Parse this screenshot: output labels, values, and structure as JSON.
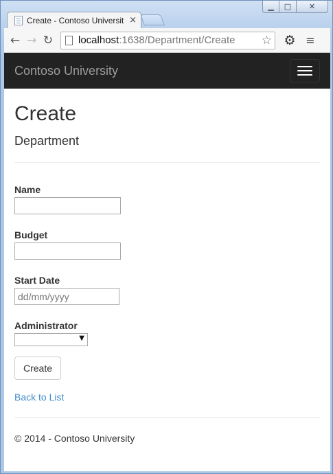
{
  "browser": {
    "tab_title": "Create - Contoso Universit",
    "tab_close": "×",
    "url_host": "localhost",
    "url_rest": ":1638/Department/Create",
    "window_min": "▁",
    "window_max": "□",
    "window_close": "✕",
    "back": "←",
    "forward": "→",
    "reload": "↻",
    "star": "☆",
    "gear": "⚙",
    "menu": "≡"
  },
  "navbar": {
    "brand": "Contoso University"
  },
  "main": {
    "title": "Create",
    "subtitle": "Department",
    "fields": {
      "name_label": "Name",
      "name_value": "",
      "budget_label": "Budget",
      "budget_value": "",
      "start_date_label": "Start Date",
      "start_date_placeholder": "dd/mm/yyyy",
      "administrator_label": "Administrator",
      "administrator_value": "",
      "dropdown_arrow": "▼"
    },
    "create_button": "Create",
    "back_link": "Back to List"
  },
  "footer": {
    "text": "© 2014 - Contoso University"
  },
  "icons": [
    "page-icon",
    "star-icon",
    "gear-icon",
    "menu-icon",
    "hamburger-icon",
    "back-icon",
    "forward-icon",
    "reload-icon"
  ],
  "colors": {
    "navbar_bg": "#222222",
    "brand_text": "#9d9d9d",
    "link": "#428bca"
  }
}
